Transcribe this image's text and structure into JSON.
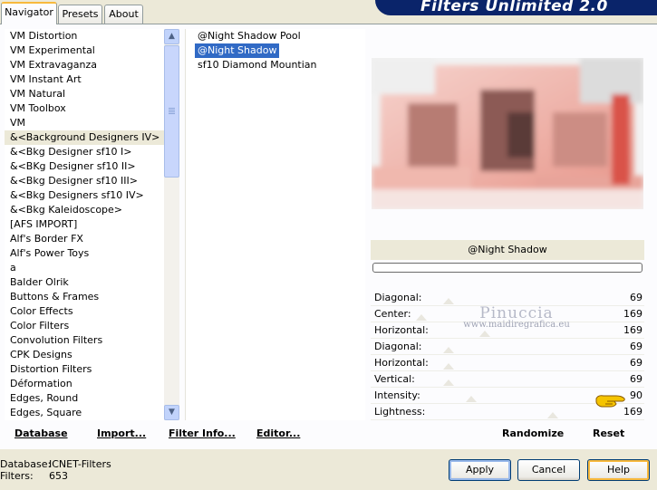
{
  "tabs": [
    {
      "label": "Navigator",
      "active": true
    },
    {
      "label": "Presets",
      "active": false
    },
    {
      "label": "About",
      "active": false
    }
  ],
  "banner": "Filters Unlimited 2.0",
  "categories": [
    "VM Distortion",
    "VM Experimental",
    "VM Extravaganza",
    "VM Instant Art",
    "VM Natural",
    "VM Toolbox",
    "VM",
    "&<Background Designers IV>",
    "&<Bkg Designer sf10 I>",
    "&<BKg Designer sf10 II>",
    "&<Bkg Designer sf10 III>",
    "&<Bkg Designers sf10 IV>",
    "&<Bkg Kaleidoscope>",
    "[AFS IMPORT]",
    "Alf's Border FX",
    "Alf's Power Toys",
    "a",
    "Balder Olrik",
    "Buttons & Frames",
    "Color Effects",
    "Color Filters",
    "Convolution Filters",
    "CPK Designs",
    "Distortion Filters",
    "Déformation",
    "Edges, Round",
    "Edges, Square"
  ],
  "selected_category": "&<Background Designers IV>",
  "filters": [
    "@Night Shadow Pool",
    "@Night Shadow",
    "sf10 Diamond Mountian"
  ],
  "selected_filter": "@Night Shadow",
  "filter_name": "@Night Shadow",
  "params": [
    {
      "label": "Diagonal:",
      "value": "69"
    },
    {
      "label": "Center:",
      "value": "169"
    },
    {
      "label": "Horizontal:",
      "value": "169"
    },
    {
      "label": "Diagonal:",
      "value": "69"
    },
    {
      "label": "Horizontal:",
      "value": "69"
    },
    {
      "label": "Vertical:",
      "value": "69"
    },
    {
      "label": "Intensity:",
      "value": "90"
    },
    {
      "label": "Lightness:",
      "value": "169"
    }
  ],
  "watermark": {
    "line1": "Pinuccia",
    "line2": "www.maidiregrafica.eu"
  },
  "links": {
    "database": "Database",
    "import": "Import...",
    "filter_info": "Filter Info...",
    "editor": "Editor...",
    "randomize": "Randomize",
    "reset": "Reset"
  },
  "footer": {
    "database_label": "Database:",
    "database_value": "ICNET-Filters",
    "filters_label": "Filters:",
    "filters_value": "653"
  },
  "buttons": {
    "apply": "Apply",
    "cancel": "Cancel",
    "help": "Help"
  }
}
